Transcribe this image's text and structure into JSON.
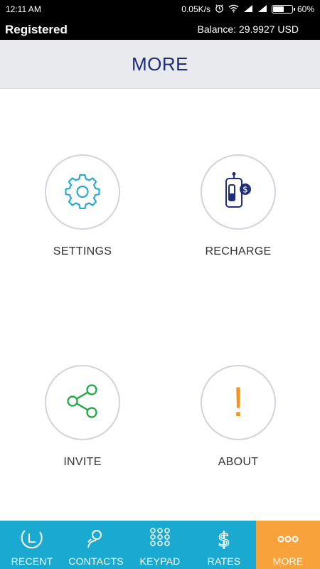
{
  "status_bar": {
    "time": "12:11 AM",
    "net_speed": "0.05K/s",
    "battery_percent": "60%",
    "battery_level": 0.6
  },
  "account": {
    "status": "Registered",
    "balance": "Balance: 29.9927 USD"
  },
  "header": {
    "title": "MORE"
  },
  "tiles": [
    {
      "label": "SETTINGS",
      "icon": "gear-icon"
    },
    {
      "label": "RECHARGE",
      "icon": "phone-dollar-icon"
    },
    {
      "label": "INVITE",
      "icon": "share-icon"
    },
    {
      "label": "ABOUT",
      "icon": "exclamation-icon",
      "glyph": "!"
    }
  ],
  "bottom_nav": [
    {
      "label": "RECENT",
      "icon": "clock-icon",
      "active": false
    },
    {
      "label": "CONTACTS",
      "icon": "contact-icon",
      "active": false
    },
    {
      "label": "KEYPAD",
      "icon": "keypad-icon",
      "active": false
    },
    {
      "label": "RATES",
      "icon": "dollar-icon",
      "active": false
    },
    {
      "label": "MORE",
      "icon": "more-icon",
      "active": true
    }
  ],
  "colors": {
    "header_title": "#1f2d7a",
    "nav_bg": "#19a9d1",
    "nav_active": "#f7a23b",
    "gear": "#29a9d4",
    "share": "#15a83a",
    "about": "#f7941d",
    "recharge": "#1f2d7a"
  }
}
